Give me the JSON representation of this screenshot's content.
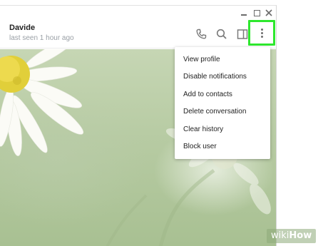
{
  "window": {
    "controls": {
      "minimize_icon": "minimize-icon",
      "maximize_icon": "maximize-icon",
      "close_icon": "close-icon"
    }
  },
  "chat_header": {
    "name": "Davide",
    "status": "last seen 1 hour ago",
    "icons": [
      "phone-icon",
      "search-icon",
      "sidebar-toggle-icon",
      "more-vertical-icon"
    ],
    "highlight_color": "#2ee82e"
  },
  "menu": {
    "items": [
      {
        "label": "View profile"
      },
      {
        "label": "Disable notifications"
      },
      {
        "label": "Add to contacts"
      },
      {
        "label": "Delete conversation"
      },
      {
        "label": "Clear history"
      },
      {
        "label": "Block user"
      }
    ]
  },
  "watermark": {
    "text_a": "wiki",
    "text_b": "How"
  }
}
